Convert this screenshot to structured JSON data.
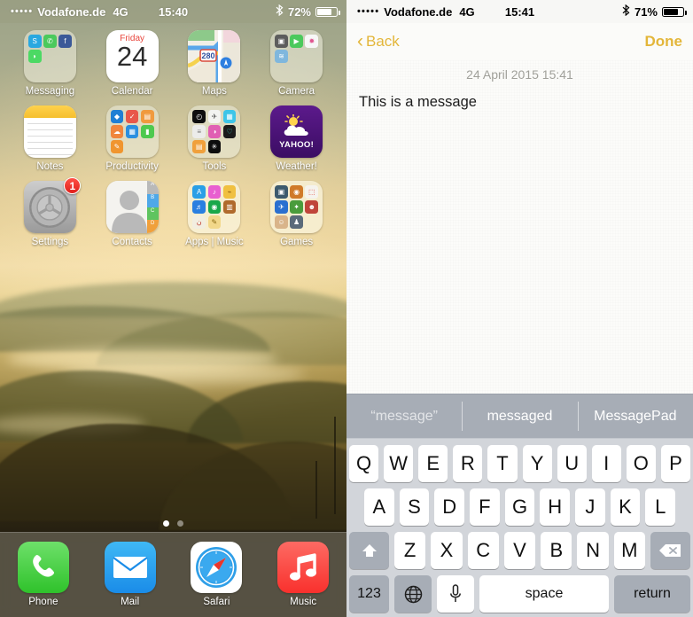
{
  "left": {
    "status": {
      "signal_dots": "•••••",
      "carrier": "Vodafone.de",
      "network": "4G",
      "time": "15:40",
      "bluetooth_icon": "bluetooth-icon",
      "battery_percent": "72%",
      "battery_level": 72
    },
    "apps": [
      [
        {
          "label": "Messaging",
          "type": "folder",
          "icon": "messaging-folder-icon",
          "minis": [
            {
              "name": "skype",
              "color": "#29a8e0",
              "glyph": "S"
            },
            {
              "name": "whatsapp",
              "color": "#4bc95c",
              "glyph": "✆"
            },
            {
              "name": "facebook",
              "color": "#3b5998",
              "glyph": "f"
            },
            {
              "name": "messages",
              "color": "#4cd964",
              "glyph": "◗"
            }
          ]
        },
        {
          "label": "Calendar",
          "type": "calendar",
          "icon": "calendar-icon",
          "weekday": "Friday",
          "day": "24"
        },
        {
          "label": "Maps",
          "type": "maps",
          "icon": "maps-icon",
          "shield": "280"
        },
        {
          "label": "Camera",
          "type": "folder",
          "icon": "camera-folder-icon",
          "minis": [
            {
              "name": "camera",
              "color": "#5d5d5d",
              "glyph": "▣"
            },
            {
              "name": "video",
              "color": "#4bc95c",
              "glyph": "▶"
            },
            {
              "name": "photos",
              "color": "#f7f7f7",
              "glyph": "✹"
            },
            {
              "name": "snapseed",
              "color": "#7fb7dd",
              "glyph": "≋"
            }
          ]
        }
      ],
      [
        {
          "label": "Notes",
          "type": "notes",
          "icon": "notes-icon"
        },
        {
          "label": "Productivity",
          "type": "folder",
          "icon": "productivity-folder-icon",
          "minis": [
            {
              "name": "dropbox",
              "color": "#1f7fd4",
              "glyph": "◆"
            },
            {
              "name": "tasks",
              "color": "#e8574a",
              "glyph": "✓"
            },
            {
              "name": "reader",
              "color": "#f09a3e",
              "glyph": "▤"
            },
            {
              "name": "weather",
              "color": "#f0863c",
              "glyph": "☁"
            },
            {
              "name": "calculator",
              "color": "#2a8fe0",
              "glyph": "▦"
            },
            {
              "name": "numbers",
              "color": "#4ec94e",
              "glyph": "▮"
            },
            {
              "name": "pages",
              "color": "#f0952f",
              "glyph": "✎"
            }
          ]
        },
        {
          "label": "Tools",
          "type": "folder",
          "icon": "tools-folder-icon",
          "minis": [
            {
              "name": "clock",
              "color": "#0e0e0e",
              "glyph": "◴"
            },
            {
              "name": "airdrop",
              "color": "#f3f3f1",
              "glyph": "✈"
            },
            {
              "name": "itunes-u",
              "color": "#3dc5e8",
              "glyph": "▦"
            },
            {
              "name": "settings2",
              "color": "#ececea",
              "glyph": "≡"
            },
            {
              "name": "colors",
              "color": "#e05fb3",
              "glyph": "◑"
            },
            {
              "name": "health",
              "color": "#1b1b1b",
              "glyph": "♡"
            },
            {
              "name": "passbook",
              "color": "#f0a03c",
              "glyph": "▤"
            },
            {
              "name": "compass",
              "color": "#0d0d0d",
              "glyph": "✳"
            }
          ]
        },
        {
          "label": "Weather!",
          "type": "yahoo",
          "icon": "yahoo-weather-icon",
          "brand": "YAHOO!"
        }
      ],
      [
        {
          "label": "Settings",
          "type": "settings",
          "icon": "settings-gear-icon",
          "badge": "1"
        },
        {
          "label": "Contacts",
          "type": "contacts",
          "icon": "contacts-icon",
          "tabs": [
            "A",
            "B",
            "C",
            "D"
          ]
        },
        {
          "label": "Apps | Music",
          "type": "folder",
          "icon": "apps-music-folder-icon",
          "minis": [
            {
              "name": "app-store",
              "color": "#2a9fe6",
              "glyph": "A"
            },
            {
              "name": "itunes",
              "color": "#e85fd0",
              "glyph": "♪"
            },
            {
              "name": "trumpet",
              "color": "#f0c040",
              "glyph": "🎺"
            },
            {
              "name": "garageband",
              "color": "#2a7fe0",
              "glyph": "🎸"
            },
            {
              "name": "spotify",
              "color": "#1aa84a",
              "glyph": "◉"
            },
            {
              "name": "leather",
              "color": "#b06a2c",
              "glyph": "▥"
            },
            {
              "name": "arabic-app",
              "color": "#f2eee0",
              "glyph": "ن"
            },
            {
              "name": "violin",
              "color": "#f2d88a",
              "glyph": "🎻"
            }
          ]
        },
        {
          "label": "Games",
          "type": "folder",
          "icon": "games-folder-icon",
          "minis": [
            {
              "name": "game1",
              "color": "#3c5a6e",
              "glyph": "▣"
            },
            {
              "name": "game2",
              "color": "#d07a2a",
              "glyph": "◉"
            },
            {
              "name": "game3",
              "color": "#f5f3ee",
              "glyph": "⬚"
            },
            {
              "name": "flight",
              "color": "#2a6fd0",
              "glyph": "✈"
            },
            {
              "name": "game5",
              "color": "#4a9c3c",
              "glyph": "✦"
            },
            {
              "name": "game6",
              "color": "#c0453a",
              "glyph": "☻"
            },
            {
              "name": "game7",
              "color": "#d9b48a",
              "glyph": "☺"
            },
            {
              "name": "game8",
              "color": "#5a6a7a",
              "glyph": "♟"
            }
          ]
        }
      ]
    ],
    "page_dots": {
      "count": 2,
      "active": 0
    },
    "dock": [
      {
        "label": "Phone",
        "icon": "phone-icon"
      },
      {
        "label": "Mail",
        "icon": "mail-icon"
      },
      {
        "label": "Safari",
        "icon": "safari-compass-icon"
      },
      {
        "label": "Music",
        "icon": "music-note-icon"
      }
    ]
  },
  "right": {
    "status": {
      "signal_dots": "•••••",
      "carrier": "Vodafone.de",
      "network": "4G",
      "time": "15:41",
      "bluetooth_icon": "bluetooth-icon",
      "battery_percent": "71%",
      "battery_level": 71
    },
    "navbar": {
      "back_label": "Back",
      "back_icon": "chevron-left-icon",
      "done_label": "Done",
      "accent_color": "#e3b63a"
    },
    "note": {
      "date": "24 April 2015 15:41",
      "text": "This is a message"
    },
    "keyboard": {
      "suggestions": [
        {
          "label": "“message”",
          "dim": true
        },
        {
          "label": "messaged",
          "dim": false
        },
        {
          "label": "MessagePad",
          "dim": false
        }
      ],
      "row1": [
        "Q",
        "W",
        "E",
        "R",
        "T",
        "Y",
        "U",
        "I",
        "O",
        "P"
      ],
      "row2": [
        "A",
        "S",
        "D",
        "F",
        "G",
        "H",
        "J",
        "K",
        "L"
      ],
      "row3": [
        "Z",
        "X",
        "C",
        "V",
        "B",
        "N",
        "M"
      ],
      "shift_icon": "shift-arrow-icon",
      "delete_icon": "backspace-delete-icon",
      "numbers_label": "123",
      "globe_icon": "globe-language-icon",
      "mic_icon": "microphone-icon",
      "space_label": "space",
      "return_label": "return"
    }
  }
}
